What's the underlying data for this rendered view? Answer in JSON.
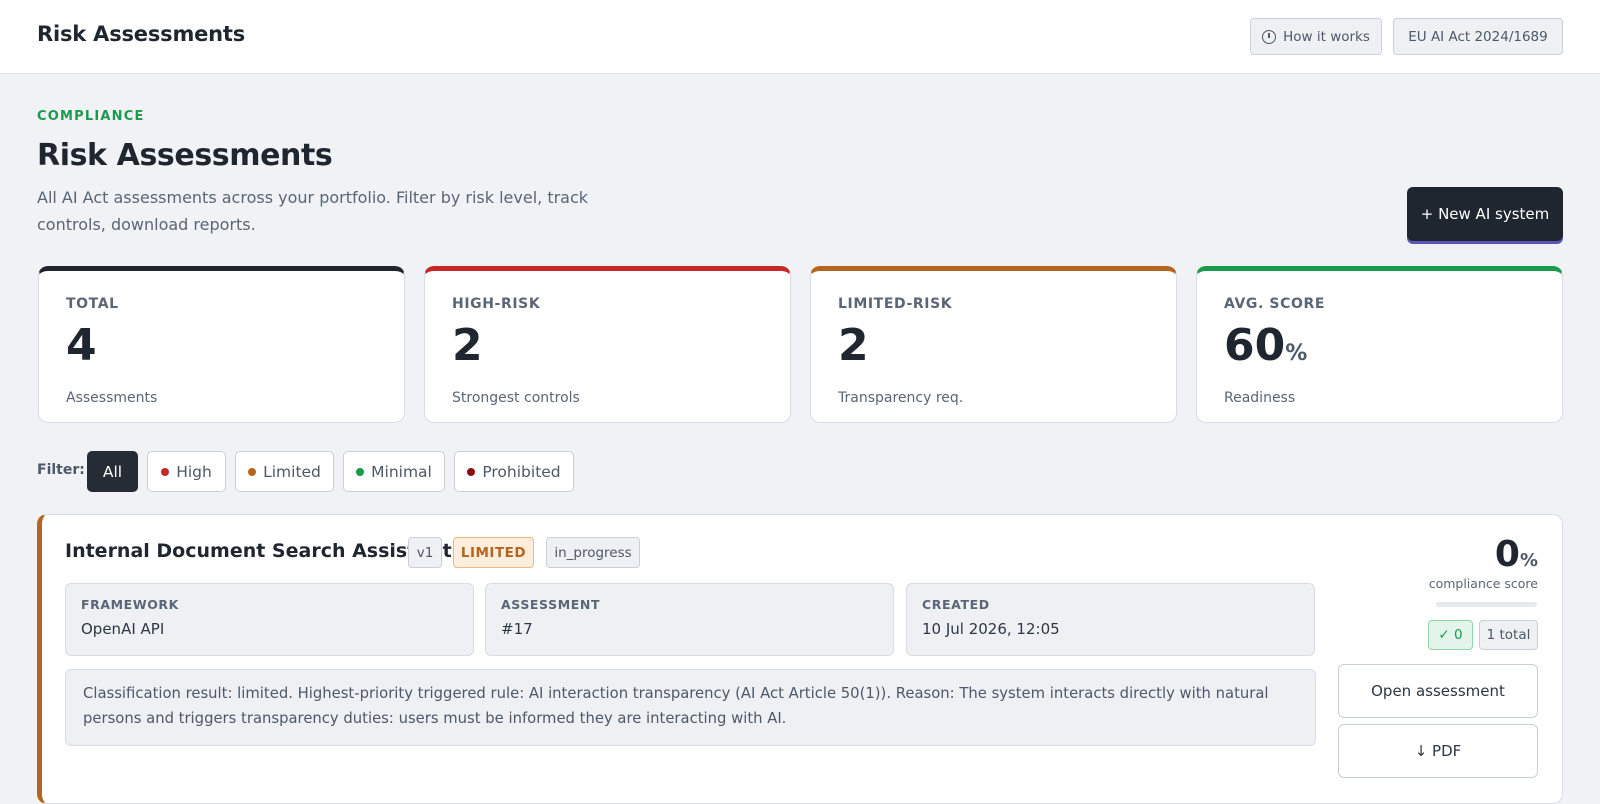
{
  "topbar": {
    "title": "Risk Assessments",
    "how_it_works": "How it works",
    "regulation": "EU AI Act 2024/1689"
  },
  "header": {
    "eyebrow": "COMPLIANCE",
    "title": "Risk Assessments",
    "description": "All AI Act assessments across your portfolio. Filter by risk level, track controls, download reports.",
    "new_button": "+ New AI system"
  },
  "stats": [
    {
      "label": "TOTAL",
      "value": "4",
      "unit": "",
      "sub": "Assessments",
      "color": "#1f2630"
    },
    {
      "label": "HIGH-RISK",
      "value": "2",
      "unit": "",
      "sub": "Strongest controls",
      "color": "#c62828"
    },
    {
      "label": "LIMITED-RISK",
      "value": "2",
      "unit": "",
      "sub": "Transparency req.",
      "color": "#b5651d"
    },
    {
      "label": "AVG. SCORE",
      "value": "60",
      "unit": "%",
      "sub": "Readiness",
      "color": "#1a9a4c"
    }
  ],
  "filter": {
    "label": "Filter:",
    "options": [
      {
        "label": "All",
        "active": true
      },
      {
        "label": "High",
        "dot": "#c62828"
      },
      {
        "label": "Limited",
        "dot": "#b5651d"
      },
      {
        "label": "Minimal",
        "dot": "#1a9a4c"
      },
      {
        "label": "Prohibited",
        "dot": "#8b0e0e"
      }
    ]
  },
  "assessment": {
    "title": "Internal Document Search Assistant",
    "version": "v1",
    "risk": "LIMITED",
    "status": "in_progress",
    "meta": [
      {
        "label": "FRAMEWORK",
        "value": "OpenAI API"
      },
      {
        "label": "ASSESSMENT",
        "value": "#17"
      },
      {
        "label": "CREATED",
        "value": "10 Jul 2026, 12:05"
      }
    ],
    "summary": "Classification result: limited. Highest-priority triggered rule: AI interaction transparency (AI Act Article 50(1)). Reason: The system interacts directly with natural persons and triggers transparency duties: users must be informed they are interacting with AI.",
    "score": "0",
    "score_unit": "%",
    "score_caption": "compliance score",
    "score_fraction": 0,
    "passed": "✓ 0",
    "total": "1 total",
    "open_button": "Open assessment",
    "pdf_button": "↓ PDF"
  }
}
